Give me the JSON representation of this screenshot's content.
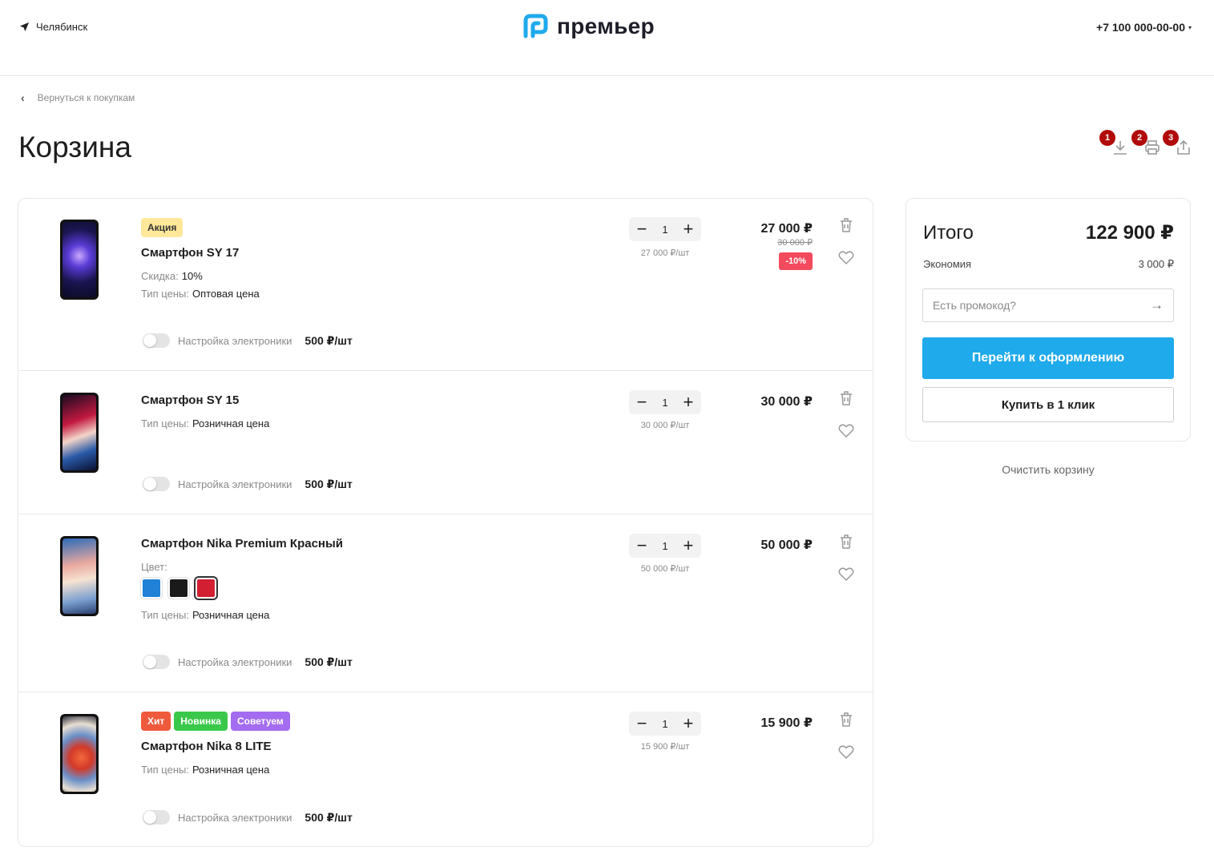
{
  "header": {
    "city": "Челябинск",
    "logo_text": "премьер",
    "phone": "+7 100 000-00-00"
  },
  "nav": {
    "back_label": "Вернуться к покупкам"
  },
  "page": {
    "title": "Корзина"
  },
  "tools": [
    {
      "num": "1",
      "icon": "download-icon"
    },
    {
      "num": "2",
      "icon": "print-icon"
    },
    {
      "num": "3",
      "icon": "share-icon"
    }
  ],
  "items": [
    {
      "name": "Смартфон SY 17",
      "badges": [
        {
          "label": "Акция",
          "color": "#ffe89a"
        }
      ],
      "props": [
        {
          "label": "Скидка:",
          "value": "10%"
        },
        {
          "label": "Тип цены:",
          "value": "Оптовая цена"
        }
      ],
      "qty": "1",
      "unit_price": "27 000 ₽/шт",
      "price": "27 000 ₽",
      "old_price": "30 000 ₽",
      "discount": "-10%",
      "service_label": "Настройка электроники",
      "service_price": "500 ₽/шт"
    },
    {
      "name": "Смартфон SY 15",
      "props": [
        {
          "label": "Тип цены:",
          "value": "Розничная цена"
        }
      ],
      "qty": "1",
      "unit_price": "30 000 ₽/шт",
      "price": "30 000 ₽",
      "service_label": "Настройка электроники",
      "service_price": "500 ₽/шт"
    },
    {
      "name": "Смартфон Nika Premium Красный",
      "color_label": "Цвет:",
      "colors": [
        "#2081d6",
        "#1a1a1a",
        "#d21f32"
      ],
      "props": [
        {
          "label": "Тип цены:",
          "value": "Розничная цена"
        }
      ],
      "qty": "1",
      "unit_price": "50 000 ₽/шт",
      "price": "50 000 ₽",
      "service_label": "Настройка электроники",
      "service_price": "500 ₽/шт"
    },
    {
      "name": "Смартфон Nika 8 LITE",
      "badges": [
        {
          "label": "Хит",
          "color": "#f05a3c"
        },
        {
          "label": "Новинка",
          "color": "#3ac84a"
        },
        {
          "label": "Советуем",
          "color": "#a46cf0"
        }
      ],
      "props": [
        {
          "label": "Тип цены:",
          "value": "Розничная цена"
        }
      ],
      "qty": "1",
      "unit_price": "15 900 ₽/шт",
      "price": "15 900 ₽",
      "service_label": "Настройка электроники",
      "service_price": "500 ₽/шт"
    }
  ],
  "qty_controls": {
    "minus": "−",
    "plus": "+"
  },
  "summary": {
    "title": "Итого",
    "total": "122 900 ₽",
    "economy_label": "Экономия",
    "economy_value": "3 000 ₽",
    "promo_placeholder": "Есть промокод?",
    "checkout_label": "Перейти к оформлению",
    "one_click_label": "Купить в 1 клик",
    "clear_label": "Очистить корзину"
  },
  "colors": {
    "accent": "#1faaec",
    "discount": "#f34a5d",
    "tool_badge": "#b10a0a"
  }
}
